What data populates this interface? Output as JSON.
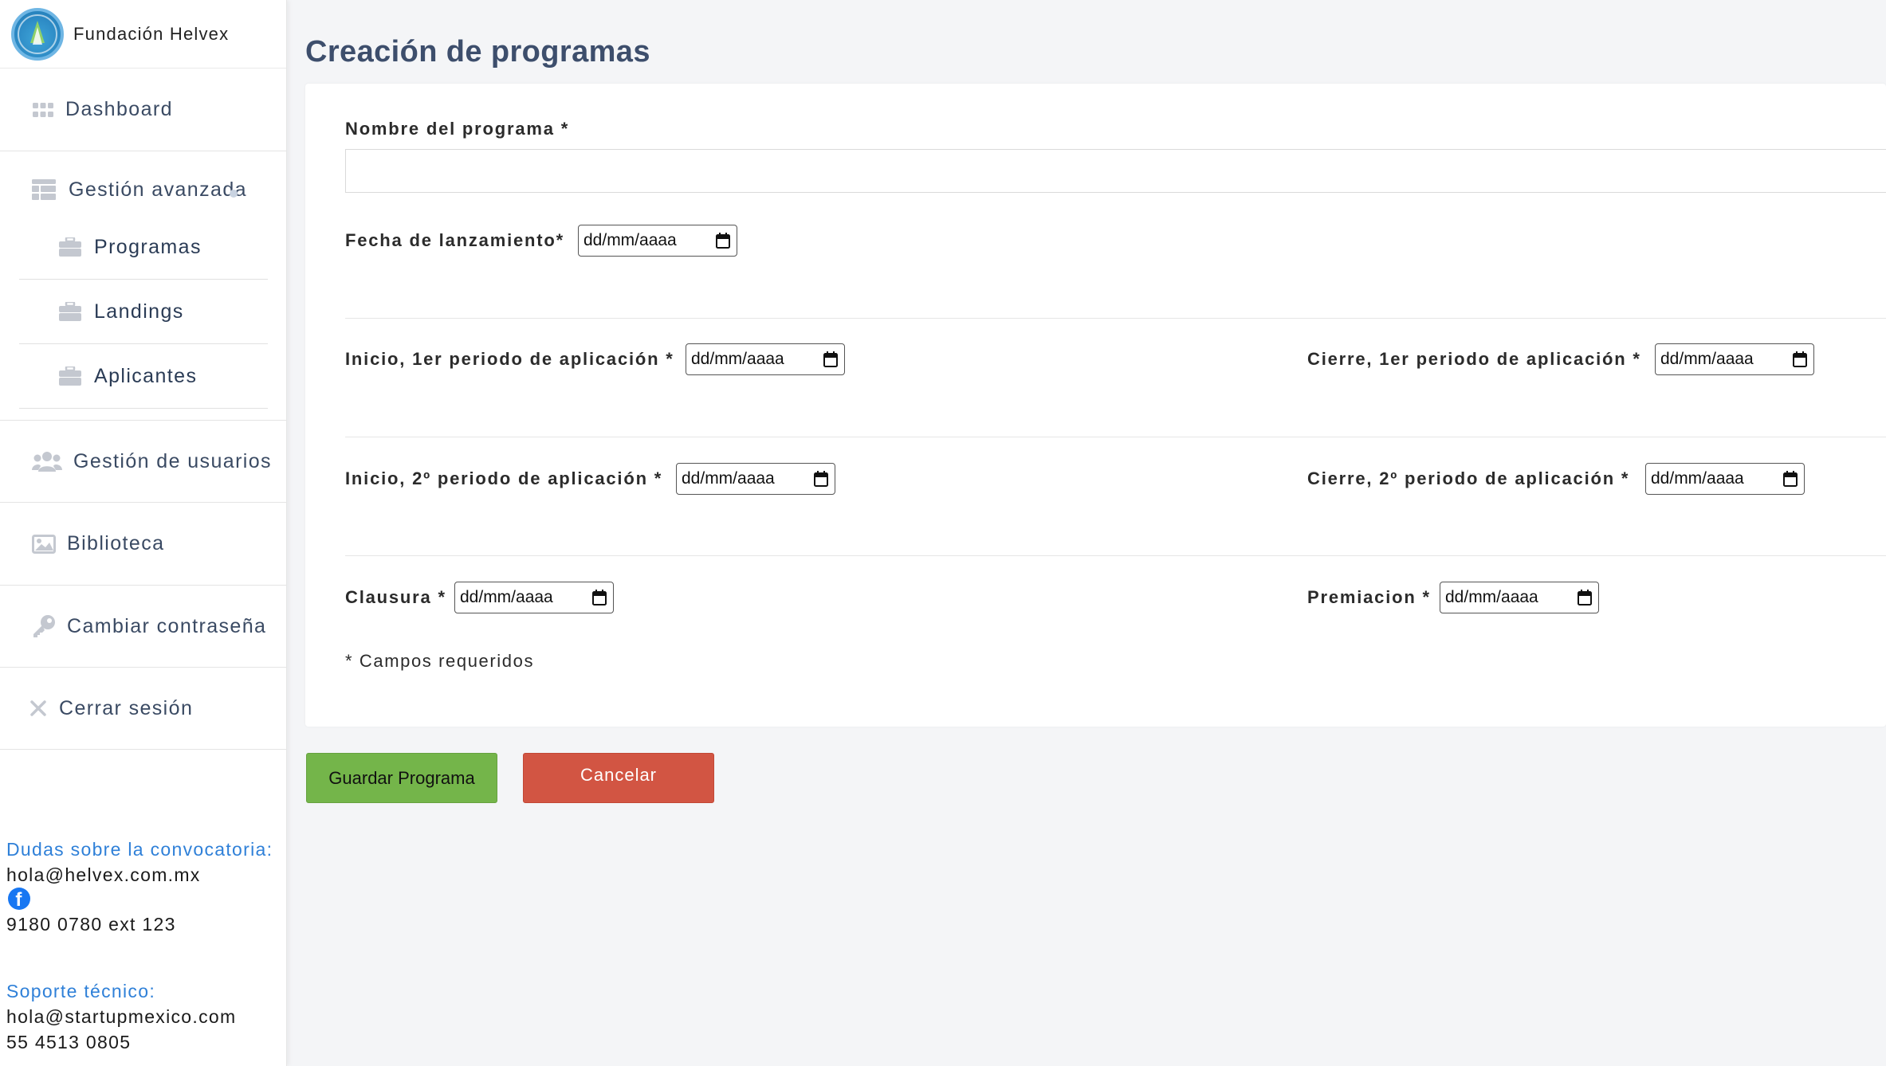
{
  "brand": {
    "name": "Fundación Helvex",
    "logo_icon": "foundation-logo"
  },
  "sidebar": {
    "dashboard": {
      "label": "Dashboard",
      "icon": "grid-icon"
    },
    "advanced": {
      "label": "Gestión avanzada",
      "icon": "table-icon",
      "items": [
        {
          "label": "Programas",
          "icon": "briefcase-icon"
        },
        {
          "label": "Landings",
          "icon": "briefcase-icon"
        },
        {
          "label": "Aplicantes",
          "icon": "briefcase-icon"
        }
      ]
    },
    "users": {
      "label": "Gestión de usuarios",
      "icon": "users-icon"
    },
    "library": {
      "label": "Biblioteca",
      "icon": "image-icon"
    },
    "password": {
      "label": "Cambiar contraseña",
      "icon": "key-icon"
    },
    "logout": {
      "label": "Cerrar sesión",
      "icon": "close-icon"
    },
    "contact": {
      "questions_label": "Dudas sobre la convocatoria:",
      "questions_email": "hola@helvex.com.mx",
      "phone": "9180 0780 ext 123",
      "support_label": "Soporte técnico:",
      "support_email": "hola@startupmexico.com",
      "support_phone": "55 4513 0805"
    }
  },
  "main": {
    "title": "Creación de programas",
    "form": {
      "program_name_label": "Nombre del programa *",
      "program_name_value": "",
      "launch_label": "Fecha de lanzamiento*",
      "start1_label": "Inicio, 1er periodo de aplicación *",
      "close1_label": "Cierre, 1er periodo de aplicación *",
      "start2_label": "Inicio, 2º periodo de aplicación *",
      "close2_label": "Cierre, 2º periodo de aplicación *",
      "closure_label": "Clausura *",
      "award_label": "Premiacion *",
      "date_placeholder": "dd/mm/aaaa",
      "required_note": "* Campos requeridos"
    },
    "buttons": {
      "save": "Guardar Programa",
      "cancel": "Cancelar"
    }
  },
  "colors": {
    "accent_text": "#3d4e6c",
    "link_blue": "#2f80d8",
    "save_green": "#74b54a",
    "cancel_red": "#d25543"
  }
}
